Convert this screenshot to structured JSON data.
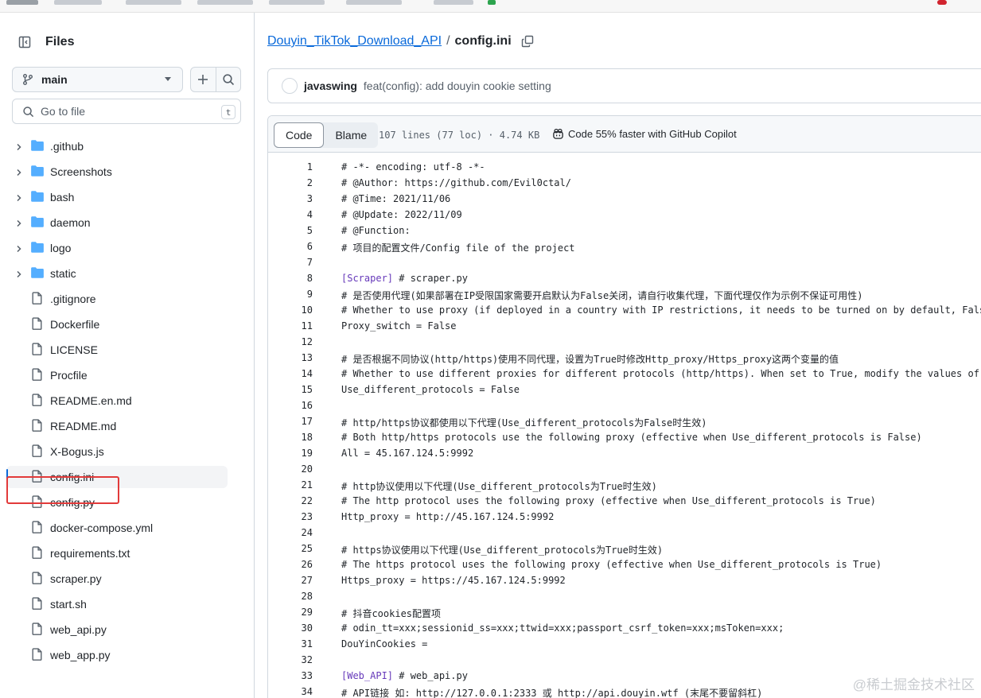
{
  "sidebar": {
    "title": "Files",
    "branch": "main",
    "search_placeholder": "Go to file",
    "search_shortcut": "t",
    "items": [
      {
        "type": "folder",
        "name": ".github"
      },
      {
        "type": "folder",
        "name": "Screenshots"
      },
      {
        "type": "folder",
        "name": "bash"
      },
      {
        "type": "folder",
        "name": "daemon"
      },
      {
        "type": "folder",
        "name": "logo"
      },
      {
        "type": "folder",
        "name": "static"
      },
      {
        "type": "file",
        "name": ".gitignore"
      },
      {
        "type": "file",
        "name": "Dockerfile"
      },
      {
        "type": "file",
        "name": "LICENSE"
      },
      {
        "type": "file",
        "name": "Procfile"
      },
      {
        "type": "file",
        "name": "README.en.md"
      },
      {
        "type": "file",
        "name": "README.md"
      },
      {
        "type": "file",
        "name": "X-Bogus.js"
      },
      {
        "type": "file",
        "name": "config.ini",
        "selected": true
      },
      {
        "type": "file",
        "name": "config.py"
      },
      {
        "type": "file",
        "name": "docker-compose.yml"
      },
      {
        "type": "file",
        "name": "requirements.txt"
      },
      {
        "type": "file",
        "name": "scraper.py"
      },
      {
        "type": "file",
        "name": "start.sh"
      },
      {
        "type": "file",
        "name": "web_api.py"
      },
      {
        "type": "file",
        "name": "web_app.py"
      }
    ]
  },
  "breadcrumb": {
    "repo": "Douyin_TikTok_Download_API",
    "separator": "/",
    "file": "config.ini"
  },
  "commit": {
    "author": "javaswing",
    "message": "feat(config): add douyin cookie setting"
  },
  "file_header": {
    "tabs": [
      "Code",
      "Blame"
    ],
    "active_tab": "Code",
    "meta": "107 lines (77 loc) · 4.74 KB",
    "copilot": "Code 55% faster with GitHub Copilot"
  },
  "code_lines": [
    {
      "n": "1",
      "t": "# -*- encoding: utf-8 -*-"
    },
    {
      "n": "2",
      "t": "# @Author: https://github.com/Evil0ctal/"
    },
    {
      "n": "3",
      "t": "# @Time: 2021/11/06"
    },
    {
      "n": "4",
      "t": "# @Update: 2022/11/09"
    },
    {
      "n": "5",
      "t": "# @Function:"
    },
    {
      "n": "6",
      "t": "# 项目的配置文件/Config file of the project"
    },
    {
      "n": "7",
      "t": ""
    },
    {
      "n": "8",
      "t": "[Scraper] # scraper.py"
    },
    {
      "n": "9",
      "t": "# 是否使用代理(如果部署在IP受限国家需要开启默认为False关闭，请自行收集代理，下面代理仅作为示例不保证可用性)"
    },
    {
      "n": "10",
      "t": "# Whether to use proxy (if deployed in a country with IP restrictions, it needs to be turned on by default, False is close"
    },
    {
      "n": "11",
      "t": "Proxy_switch = False"
    },
    {
      "n": "12",
      "t": ""
    },
    {
      "n": "13",
      "t": "# 是否根据不同协议(http/https)使用不同代理，设置为True时修改Http_proxy/Https_proxy这两个变量的值"
    },
    {
      "n": "14",
      "t": "# Whether to use different proxies for different protocols (http/https). When set to True, modify the values of the two va"
    },
    {
      "n": "15",
      "t": "Use_different_protocols = False"
    },
    {
      "n": "16",
      "t": ""
    },
    {
      "n": "17",
      "t": "# http/https协议都使用以下代理(Use_different_protocols为False时生效)"
    },
    {
      "n": "18",
      "t": "# Both http/https protocols use the following proxy (effective when Use_different_protocols is False)"
    },
    {
      "n": "19",
      "t": "All = 45.167.124.5:9992"
    },
    {
      "n": "20",
      "t": ""
    },
    {
      "n": "21",
      "t": "# http协议使用以下代理(Use_different_protocols为True时生效)"
    },
    {
      "n": "22",
      "t": "# The http protocol uses the following proxy (effective when Use_different_protocols is True)"
    },
    {
      "n": "23",
      "t": "Http_proxy = http://45.167.124.5:9992"
    },
    {
      "n": "24",
      "t": ""
    },
    {
      "n": "25",
      "t": "# https协议使用以下代理(Use_different_protocols为True时生效)"
    },
    {
      "n": "26",
      "t": "# The https protocol uses the following proxy (effective when Use_different_protocols is True)"
    },
    {
      "n": "27",
      "t": "Https_proxy = https://45.167.124.5:9992"
    },
    {
      "n": "28",
      "t": ""
    },
    {
      "n": "29",
      "t": "# 抖音cookies配置项"
    },
    {
      "n": "30",
      "t": "# odin_tt=xxx;sessionid_ss=xxx;ttwid=xxx;passport_csrf_token=xxx;msToken=xxx;"
    },
    {
      "n": "31",
      "t": "DouYinCookies ="
    },
    {
      "n": "32",
      "t": ""
    },
    {
      "n": "33",
      "t": "[Web_API] # web_api.py"
    },
    {
      "n": "34",
      "t": "# API链接 如: http://127.0.0.1:2333 或 http://api.douyin.wtf (末尾不要留斜杠)"
    }
  ],
  "watermark": "@稀土掘金技术社区",
  "colors": {
    "link": "#0969da",
    "folder": "#54aeff",
    "highlight_box": "#e23a3a",
    "section": "#6639ba"
  }
}
